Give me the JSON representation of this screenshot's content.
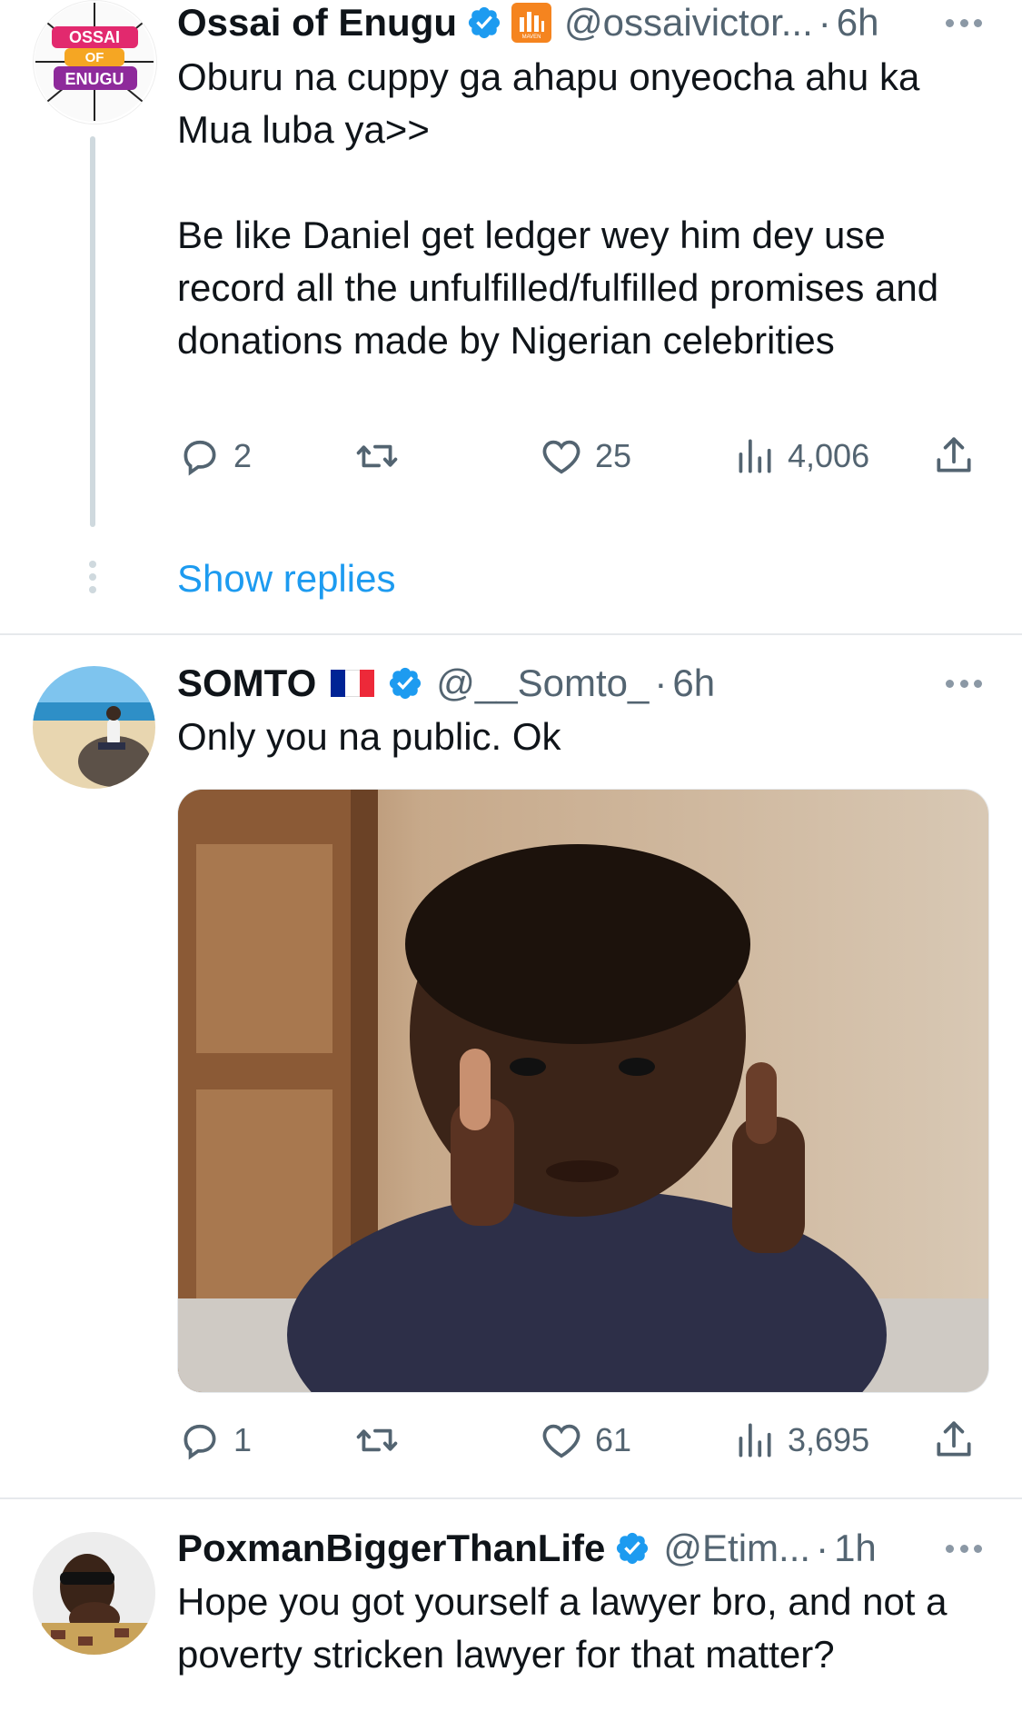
{
  "tweets": [
    {
      "display_name": "Ossai of Enugu",
      "handle": "@ossaivictor...",
      "time": "6h",
      "avatar_text": "OSSAI OF ENUGU",
      "affiliate_badge_text": "MAVEN",
      "text": "Oburu na cuppy ga ahapu onyeocha ahu ka Mua luba ya>>\n\nBe like Daniel get ledger wey him dey use record all the unfulfilled/fulfilled promises and  donations made by Nigerian celebrities",
      "replies": "2",
      "retweets": "",
      "likes": "25",
      "views": "4,006",
      "show_replies": "Show replies"
    },
    {
      "display_name": "SOMTO",
      "flag": "🇫🇷",
      "handle": "@__Somto_",
      "time": "6h",
      "text": "Only you na public. Ok",
      "media_description": "kid giving thumbs up",
      "replies": "1",
      "retweets": "",
      "likes": "61",
      "views": "3,695"
    },
    {
      "display_name": "PoxmanBiggerThanLife",
      "handle": "@Etim...",
      "time": "1h",
      "text": "Hope you got yourself a lawyer bro, and not a poverty stricken lawyer for that matter?"
    }
  ],
  "separator": "·",
  "colors": {
    "verified": "#1d9bf0",
    "link": "#1d9bf0",
    "muted": "#536471",
    "affiliate_badge": "#f5841f"
  },
  "icons": [
    "reply-icon",
    "retweet-icon",
    "like-icon",
    "views-icon",
    "share-icon",
    "verified-icon",
    "more-icon"
  ]
}
